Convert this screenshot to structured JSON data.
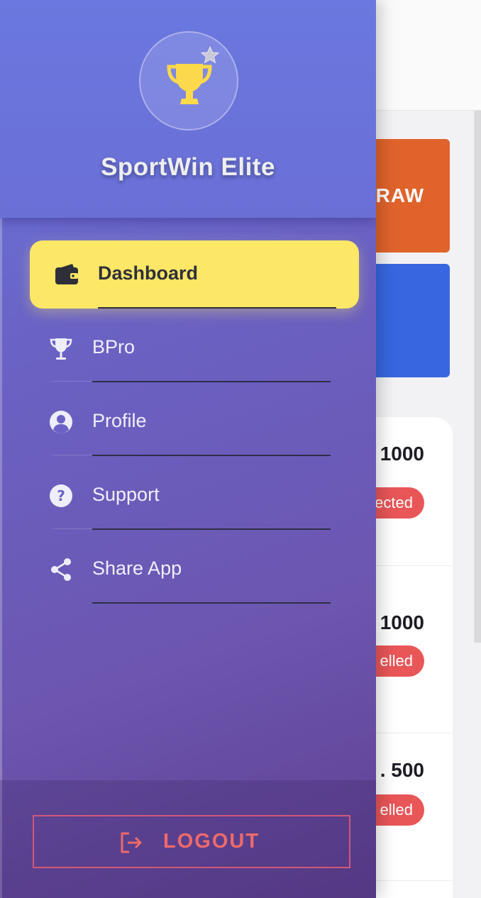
{
  "app": {
    "name": "SportWin Elite"
  },
  "menu": {
    "items": [
      {
        "label": "Dashboard",
        "icon": "wallet-icon",
        "active": true
      },
      {
        "label": "BPro",
        "icon": "trophy-icon",
        "active": false
      },
      {
        "label": "Profile",
        "icon": "user-circle-icon",
        "active": false
      },
      {
        "label": "Support",
        "icon": "question-circle-icon",
        "active": false
      },
      {
        "label": "Share App",
        "icon": "share-icon",
        "active": false
      }
    ]
  },
  "footer": {
    "logout_label": "LOGOUT",
    "logout_icon": "sign-out-icon"
  },
  "background": {
    "withdraw_label_fragment": "RAW",
    "rows": [
      {
        "amount_fragment": "1000",
        "status_fragment": "ected"
      },
      {
        "amount_fragment": "1000",
        "status_fragment": "elled"
      },
      {
        "amount_fragment": ". 500",
        "status_fragment": "elled"
      }
    ]
  },
  "colors": {
    "drawer_gradient_start": "#6b79e0",
    "drawer_gradient_end": "#5e3f90",
    "active_item": "#fce766",
    "logout": "#ee6a6a",
    "withdraw_button": "#e0632b",
    "blue_button": "#3766e0",
    "status_badge": "#e95658"
  }
}
